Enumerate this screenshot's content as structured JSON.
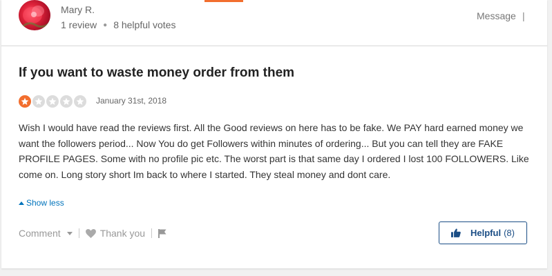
{
  "reviewer": {
    "name": "Mary R.",
    "review_count": "1 review",
    "helpful_votes": "8 helpful votes",
    "message_label": "Message",
    "message_separator": "|"
  },
  "review": {
    "title": "If you want to waste money order from them",
    "rating": 1,
    "rating_max": 5,
    "date": "January 31st, 2018",
    "body": "Wish I would have read the reviews first. All the Good reviews on here has to be fake. We PAY hard earned money we want the followers period... Now You do get Followers within minutes of ordering... But you can tell they are FAKE PROFILE PAGES. Some with no profile pic etc. The worst part is that same day I ordered I lost 100 FOLLOWERS. Like come on. Long story short Im back to where I started. They steal money and dont care.",
    "show_less_label": "Show less"
  },
  "actions": {
    "comment_label": "Comment",
    "thank_you_label": "Thank you",
    "helpful_label": "Helpful",
    "helpful_count": "(8)"
  },
  "colors": {
    "accent": "#f26e2e",
    "link": "#0073bb",
    "helpful_border": "#1a4d85"
  },
  "icons": {
    "avatar": "avatar-flower-photo",
    "star_filled": "star-icon",
    "star_empty": "star-outline-icon",
    "comment_caret": "caret-down-icon",
    "thank_you": "heart-icon",
    "flag": "flag-icon",
    "helpful": "thumbs-up-icon",
    "show_less": "caret-up-icon"
  }
}
